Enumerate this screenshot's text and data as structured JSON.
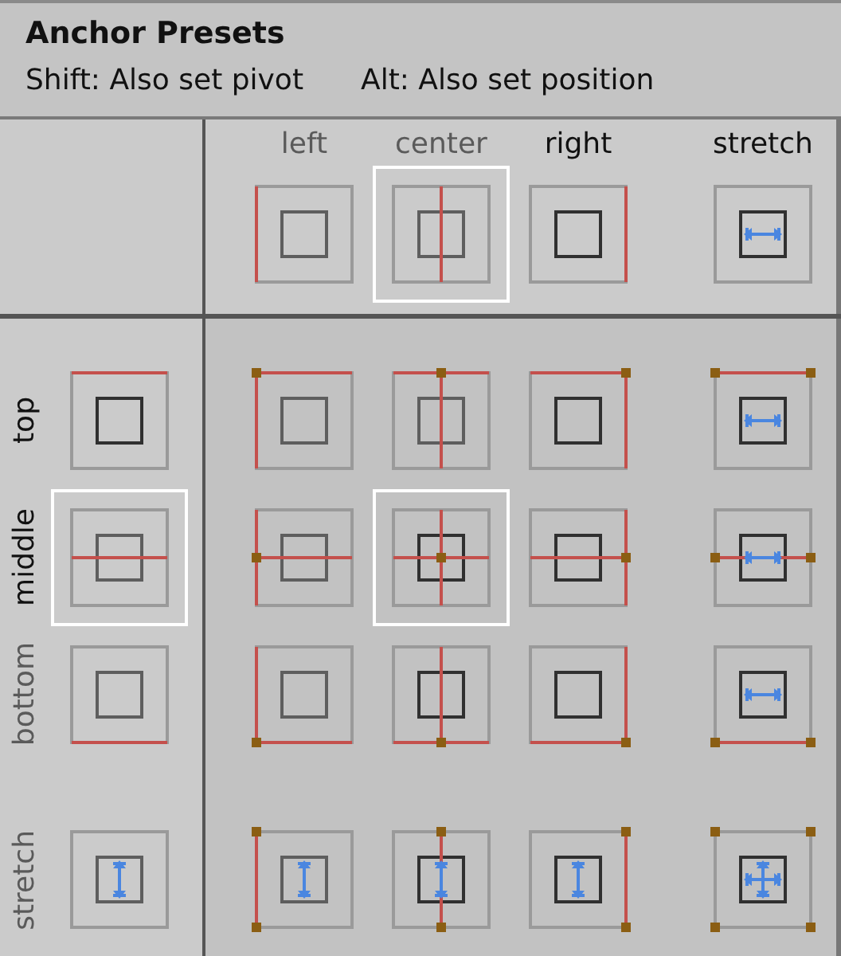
{
  "title": "Anchor Presets",
  "hints": [
    "Shift: Also set pivot",
    "Alt: Also set position"
  ],
  "columns": [
    {
      "label": "left",
      "kind": "left",
      "dimmed": true,
      "selected": false,
      "emphasized": false
    },
    {
      "label": "center",
      "kind": "center",
      "dimmed": true,
      "selected": true,
      "emphasized": false
    },
    {
      "label": "right",
      "kind": "right",
      "dimmed": false,
      "selected": false,
      "emphasized": true
    },
    {
      "label": "stretch",
      "kind": "stretch",
      "dimmed": false,
      "selected": false,
      "emphasized": true
    }
  ],
  "rows": [
    {
      "label": "top",
      "kind": "top",
      "dimmed": false,
      "selected": false,
      "emphasized": true,
      "cells": [
        {
          "selected": false,
          "emphasized": false
        },
        {
          "selected": false,
          "emphasized": false
        },
        {
          "selected": false,
          "emphasized": true
        },
        {
          "selected": false,
          "emphasized": true
        }
      ]
    },
    {
      "label": "middle",
      "kind": "middle",
      "dimmed": false,
      "selected": true,
      "emphasized": false,
      "cells": [
        {
          "selected": false,
          "emphasized": false
        },
        {
          "selected": true,
          "emphasized": true
        },
        {
          "selected": false,
          "emphasized": true
        },
        {
          "selected": false,
          "emphasized": true
        }
      ]
    },
    {
      "label": "bottom",
      "kind": "bottom",
      "dimmed": true,
      "selected": false,
      "emphasized": false,
      "cells": [
        {
          "selected": false,
          "emphasized": false
        },
        {
          "selected": false,
          "emphasized": true
        },
        {
          "selected": false,
          "emphasized": true
        },
        {
          "selected": false,
          "emphasized": true
        }
      ]
    },
    {
      "label": "stretch",
      "kind": "stretch",
      "dimmed": true,
      "selected": false,
      "emphasized": false,
      "cells": [
        {
          "selected": false,
          "emphasized": false
        },
        {
          "selected": false,
          "emphasized": true
        },
        {
          "selected": false,
          "emphasized": true
        },
        {
          "selected": false,
          "emphasized": true
        }
      ]
    }
  ]
}
